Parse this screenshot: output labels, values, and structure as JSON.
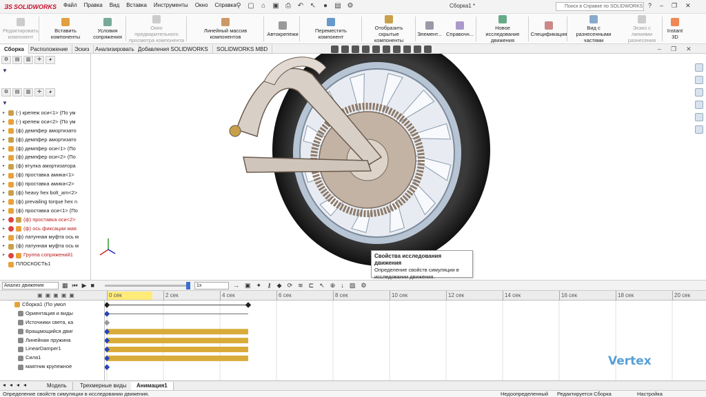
{
  "app": {
    "brand": "SOLIDWORKS",
    "window_title": "Сборка1 *"
  },
  "menu": [
    "Файл",
    "Правка",
    "Вид",
    "Вставка",
    "Инструменты",
    "Окно",
    "Справка"
  ],
  "search": {
    "placeholder": "Поиск в Справке по SOLIDWORKS"
  },
  "ribbon": [
    {
      "label": "Редактировать компонент",
      "disabled": true
    },
    {
      "label": "Вставить компоненты",
      "disabled": false
    },
    {
      "label": "Условия сопряжения",
      "disabled": false
    },
    {
      "label": "Окно предварительного просмотра компонента",
      "disabled": true
    },
    {
      "label": "Линейный массив компонентов",
      "disabled": false
    },
    {
      "label": "Автокрепежи",
      "disabled": false
    },
    {
      "label": "Переместить компонент",
      "disabled": false
    },
    {
      "label": "Отобразить скрытые компоненты",
      "disabled": false
    },
    {
      "label": "Элемент...",
      "disabled": false
    },
    {
      "label": "Справочн...",
      "disabled": false
    },
    {
      "label": "Новое исследование движения",
      "disabled": false
    },
    {
      "label": "Спецификация",
      "disabled": false
    },
    {
      "label": "Вид с разнесенными частями",
      "disabled": false
    },
    {
      "label": "Эскиз с линиями разнесения",
      "disabled": true
    },
    {
      "label": "Instant 3D",
      "disabled": false
    }
  ],
  "cm_tabs": [
    "Сборка",
    "Расположение",
    "Эскиз",
    "Анализировать",
    "Добавления SOLIDWORKS",
    "SOLIDWORKS MBD"
  ],
  "tree": [
    {
      "label": "(-) крепеж оси<1> (По ум",
      "red": false,
      "err": false
    },
    {
      "label": "(-) крепеж оси<2> (По ум",
      "red": false,
      "err": false
    },
    {
      "label": "(ф) демпфер амортизато",
      "red": false,
      "err": false
    },
    {
      "label": "(ф) демпфер амортизато",
      "red": false,
      "err": false
    },
    {
      "label": "(ф) демпфер оси<1> (По",
      "red": false,
      "err": false
    },
    {
      "label": "(ф) демпфер оси<2> (По",
      "red": false,
      "err": false
    },
    {
      "label": "(ф) втулка амортизатора",
      "red": false,
      "err": false
    },
    {
      "label": "(ф) проставка амика<1>",
      "red": false,
      "err": false
    },
    {
      "label": "(ф) проставка амика<2>",
      "red": false,
      "err": false
    },
    {
      "label": "(ф) heavy hex bolt_am<2>",
      "red": false,
      "err": false
    },
    {
      "label": "(ф) prevailing torque hex n",
      "red": false,
      "err": false
    },
    {
      "label": "(ф) проставка оси<1> (По",
      "red": false,
      "err": false
    },
    {
      "label": "(ф) проставка оси<2>",
      "red": true,
      "err": true
    },
    {
      "label": "(ф) ось фиксации мая",
      "red": true,
      "err": true
    },
    {
      "label": "(ф) латунная муфта ось м",
      "red": false,
      "err": false
    },
    {
      "label": "(ф) латунная муфта ось м",
      "red": false,
      "err": false
    },
    {
      "label": "Группа сопряжений1",
      "red": true,
      "err": true
    },
    {
      "label": "ПЛОСКОСТЬ1",
      "red": false,
      "err": false
    }
  ],
  "tooltip": {
    "title": "Свойства исследования движения",
    "body": "Определение свойств симуляции в исследовании движения."
  },
  "motion": {
    "study_type": "Анализ движения",
    "playback_speed": "1x",
    "time_ticks": [
      "0 сек",
      "2 сек",
      "4 сек",
      "6 сек",
      "8 сек",
      "10 сек",
      "12 сек",
      "14 сек",
      "16 сек",
      "18 сек",
      "20 сек"
    ],
    "tree": [
      {
        "label": "Сборка1  (По умол"
      },
      {
        "label": "Ориентация и виды"
      },
      {
        "label": "Источники света, ка"
      },
      {
        "label": "Вращающийся двиг"
      },
      {
        "label": "Линейная пружина"
      },
      {
        "label": "LinearDamper1"
      },
      {
        "label": "Сила1"
      },
      {
        "label": "маятник крупежное"
      }
    ],
    "bars_end_sec": 5
  },
  "bottom_tabs": [
    "Модель",
    "Трехмерные виды",
    "Анимация1"
  ],
  "status": {
    "left": "Определение свойств симуляции в исследовании движения.",
    "s1": "Недоопределенный",
    "s2": "Редактируется Сборка",
    "s3": "Настройка"
  },
  "watermark": "Vertex",
  "colors": {
    "bar": "#d9ac3a",
    "keyframe": "#2846b8",
    "playhead": "#ffeb7a",
    "error": "#d44444"
  }
}
